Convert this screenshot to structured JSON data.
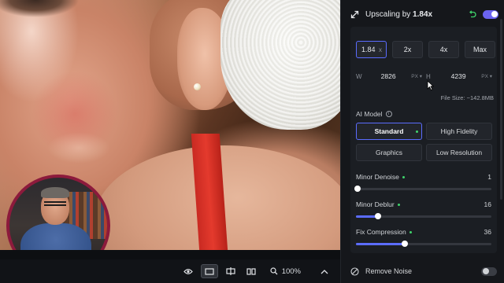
{
  "panel": {
    "header": {
      "title_prefix": "Upscaling by",
      "title_value": "1.84x",
      "enabled": true
    },
    "scale": {
      "input_value": "1.84",
      "input_suffix": "x",
      "presets": [
        "2x",
        "4x",
        "Max"
      ]
    },
    "dimensions": {
      "width_label": "W",
      "width_value": "2826",
      "height_label": "H",
      "height_value": "4239",
      "unit": "PX"
    },
    "file_size": "File Size: ~142.8MB",
    "ai_model": {
      "label": "AI Model",
      "options": [
        "Standard",
        "High Fidelity",
        "Graphics",
        "Low Resolution"
      ],
      "selected": "Standard"
    },
    "sliders": [
      {
        "name": "Minor Denoise",
        "value": "1",
        "level": 1
      },
      {
        "name": "Minor Deblur",
        "value": "16",
        "level": 16
      },
      {
        "name": "Fix Compression",
        "value": "36",
        "level": 36
      }
    ],
    "remove_noise": {
      "label": "Remove Noise",
      "enabled": false
    }
  },
  "toolbar": {
    "zoom": "100%"
  },
  "colors": {
    "accent": "#5b6cff",
    "toggle_on": "#6b63f0",
    "status_dot": "#3fd46b",
    "webcam_ring": "#8c1a3c"
  },
  "icons": [
    "expand-icon",
    "undo-icon",
    "info-icon",
    "eye-icon",
    "single-view-icon",
    "split-view-icon",
    "side-by-side-icon",
    "zoom-icon",
    "chevron-up-icon",
    "remove-noise-icon"
  ]
}
